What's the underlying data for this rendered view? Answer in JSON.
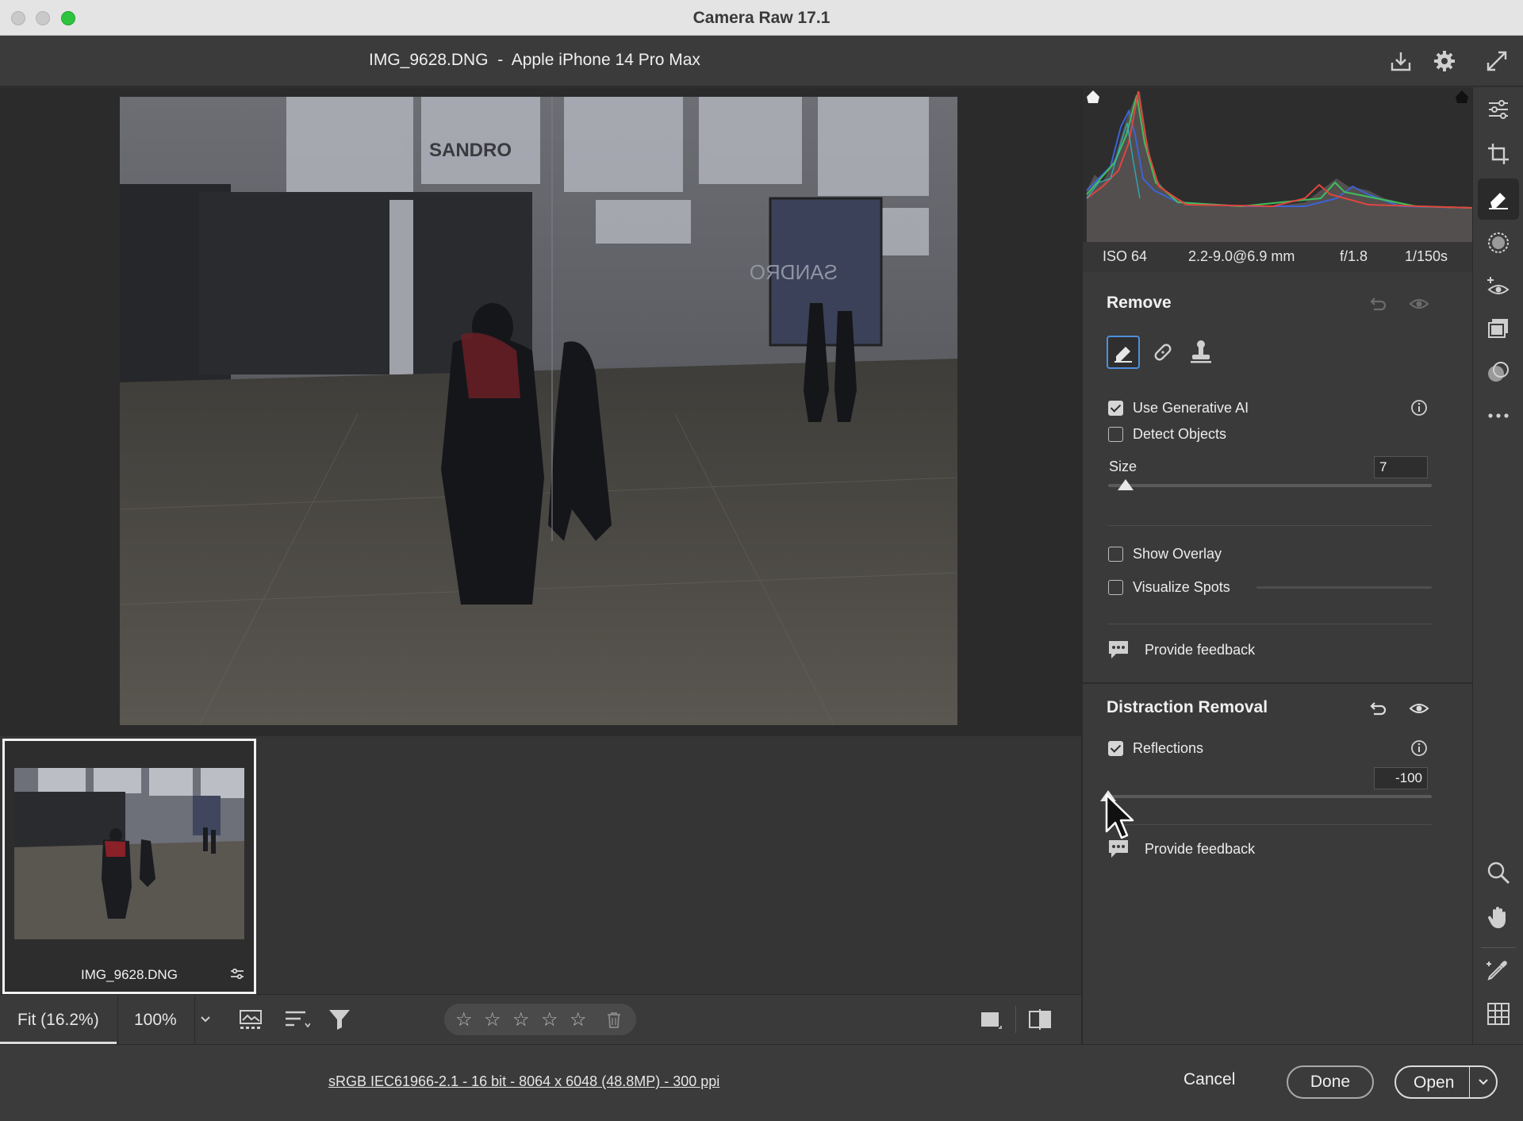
{
  "window": {
    "title": "Camera Raw 17.1"
  },
  "header": {
    "file_title": "IMG_9628.DNG  -  Apple iPhone 14 Pro Max",
    "icons": [
      "save-icon",
      "gear-icon",
      "fullscreen-icon"
    ]
  },
  "filmstrip": {
    "items": [
      {
        "name": "IMG_9628.DNG",
        "edited": true
      }
    ]
  },
  "toolbar": {
    "zoom_fit": "Fit (16.2%)",
    "zoom_100": "100%",
    "rating_stars": 5
  },
  "status": {
    "workflow": "sRGB IEC61966-2.1 - 16 bit - 8064 x 6048 (48.8MP) - 300 ppi",
    "cancel": "Cancel",
    "done": "Done",
    "open": "Open"
  },
  "exif": {
    "iso": "ISO 64",
    "lens": "2.2-9.0@6.9 mm",
    "aperture": "f/1.8",
    "shutter": "1/150s"
  },
  "remove": {
    "title": "Remove",
    "use_generative_ai": {
      "label": "Use Generative AI",
      "checked": true
    },
    "detect_objects": {
      "label": "Detect Objects",
      "checked": false
    },
    "size": {
      "label": "Size",
      "value": "7",
      "level": 0.06
    },
    "show_overlay": {
      "label": "Show Overlay",
      "checked": false
    },
    "visualize_spots": {
      "label": "Visualize Spots",
      "checked": false
    },
    "feedback": "Provide feedback"
  },
  "distraction": {
    "title": "Distraction Removal",
    "reflections": {
      "label": "Reflections",
      "checked": true,
      "value": "-100",
      "level": 0.0
    },
    "feedback": "Provide feedback"
  },
  "colors": {
    "accent": "#4f8fdc",
    "panel_bg": "#3a3a3a",
    "stage_bg": "#2b2b2b"
  }
}
